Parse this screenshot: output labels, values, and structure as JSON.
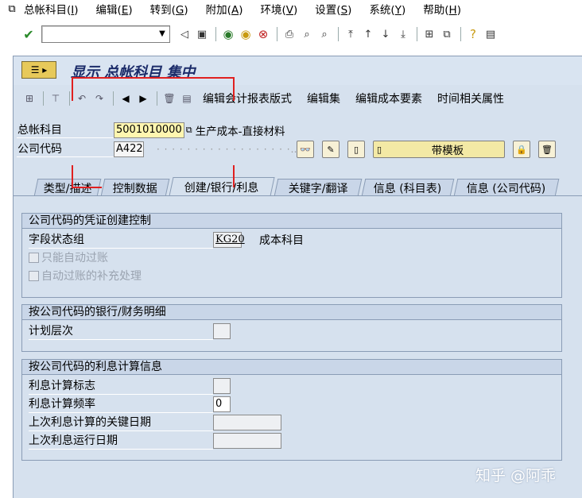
{
  "menu": {
    "items": [
      {
        "label": "总帐科目(",
        "key": "I",
        "end": ")"
      },
      {
        "label": "编辑(",
        "key": "E",
        "end": ")"
      },
      {
        "label": "转到(",
        "key": "G",
        "end": ")"
      },
      {
        "label": "附加(",
        "key": "A",
        "end": ")"
      },
      {
        "label": "环境(",
        "key": "V",
        "end": ")"
      },
      {
        "label": "设置(",
        "key": "S",
        "end": ")"
      },
      {
        "label": "系统(",
        "key": "Y",
        "end": ")"
      },
      {
        "label": "帮助(",
        "key": "H",
        "end": ")"
      }
    ]
  },
  "command_field": {
    "value": ""
  },
  "title": "显示 总帐科目 集中",
  "app_toolbar": {
    "buttons": [
      "编辑会计报表版式",
      "编辑集",
      "编辑成本要素",
      "时间相关属性"
    ]
  },
  "header": {
    "account_label": "总帐科目",
    "account_value": "5001010000",
    "account_desc": "生产成本-直接材料",
    "company_label": "公司代码",
    "company_value": "A422",
    "company_desc_blurred": "...",
    "template_button": "带模板"
  },
  "tabs": [
    {
      "label": "类型/描述",
      "active": false
    },
    {
      "label": "控制数据",
      "active": false
    },
    {
      "label": "创建/银行/利息",
      "active": true
    },
    {
      "label": "关键字/翻译",
      "active": false
    },
    {
      "label": "信息 (科目表)",
      "active": false
    },
    {
      "label": "信息 (公司代码)",
      "active": false
    }
  ],
  "group1": {
    "title": "公司代码的凭证创建控制",
    "field_status_label": "字段状态组",
    "field_status_value": "KG20",
    "field_status_desc": "成本科目",
    "chk_auto_post": "只能自动过账",
    "chk_supplement": "自动过账的补充处理"
  },
  "group2": {
    "title": "按公司代码的银行/财务明细",
    "planning_level_label": "计划层次",
    "planning_level_value": ""
  },
  "group3": {
    "title": "按公司代码的利息计算信息",
    "interest_indicator_label": "利息计算标志",
    "interest_indicator_value": "",
    "interest_freq_label": "利息计算频率",
    "interest_freq_value": "0",
    "last_key_date_label": "上次利息计算的关键日期",
    "last_key_date_value": "",
    "last_run_date_label": "上次利息运行日期",
    "last_run_date_value": ""
  },
  "watermark": "知乎 @阿乖",
  "colors": {
    "frame": "#d6e1ee",
    "title_text": "#1c2c6a",
    "annotation": "#e02020"
  }
}
